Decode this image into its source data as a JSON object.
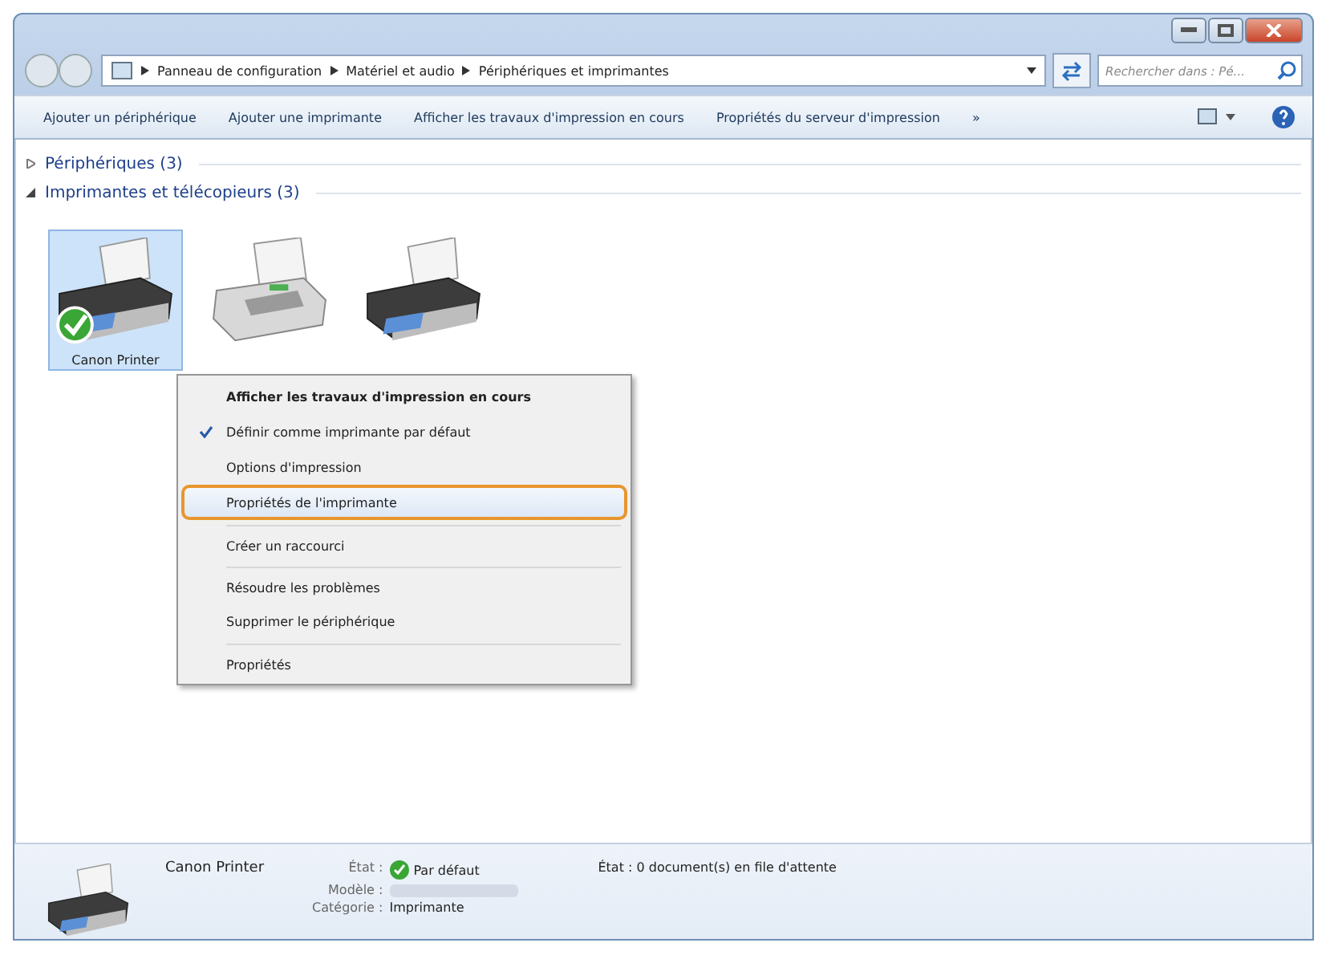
{
  "address_bar": {
    "crumbs": [
      "Panneau de configuration",
      "Matériel et audio",
      "Périphériques et imprimantes"
    ]
  },
  "search": {
    "placeholder": "Rechercher dans : Pé..."
  },
  "toolbar": {
    "buttons": [
      "Ajouter un périphérique",
      "Ajouter une imprimante",
      "Afficher les travaux d'impression en cours",
      "Propriétés du serveur d'impression"
    ],
    "overflow": "»"
  },
  "groups": [
    {
      "title": "Périphériques (3)",
      "expanded": false
    },
    {
      "title": "Imprimantes et télécopieurs (3)",
      "expanded": true,
      "devices": [
        {
          "label": "Canon Printer",
          "kind": "printer",
          "selected": true,
          "default": true
        },
        {
          "kind": "fax",
          "selected": false,
          "default": false
        },
        {
          "kind": "printer",
          "selected": false,
          "default": false
        }
      ]
    }
  ],
  "context_menu": {
    "items": [
      {
        "label": "Afficher les travaux d'impression en cours",
        "bold": true,
        "checked": false,
        "highlighted": false,
        "separator_before": false
      },
      {
        "label": "Définir comme imprimante par défaut",
        "bold": false,
        "checked": true,
        "highlighted": false,
        "separator_before": false
      },
      {
        "label": "Options d'impression",
        "bold": false,
        "checked": false,
        "highlighted": false,
        "separator_before": false
      },
      {
        "label": "Propriétés de l'imprimante",
        "bold": false,
        "checked": false,
        "highlighted": true,
        "separator_before": false
      },
      {
        "label": "Créer un raccourci",
        "bold": false,
        "checked": false,
        "highlighted": false,
        "separator_before": true
      },
      {
        "label": "Résoudre les problèmes",
        "bold": false,
        "checked": false,
        "highlighted": false,
        "separator_before": true
      },
      {
        "label": "Supprimer le périphérique",
        "bold": false,
        "checked": false,
        "highlighted": false,
        "separator_before": false
      },
      {
        "label": "Propriétés",
        "bold": false,
        "checked": false,
        "highlighted": false,
        "separator_before": true
      }
    ]
  },
  "details": {
    "name": "Canon Printer",
    "fields": [
      {
        "label": "État :",
        "value": "Par défaut",
        "kind": "status"
      },
      {
        "label": "Modèle :",
        "kind": "blurred"
      },
      {
        "label": "Catégorie :",
        "value": "Imprimante",
        "kind": "text"
      }
    ],
    "queue": "État : 0 document(s) en file d'attente"
  }
}
